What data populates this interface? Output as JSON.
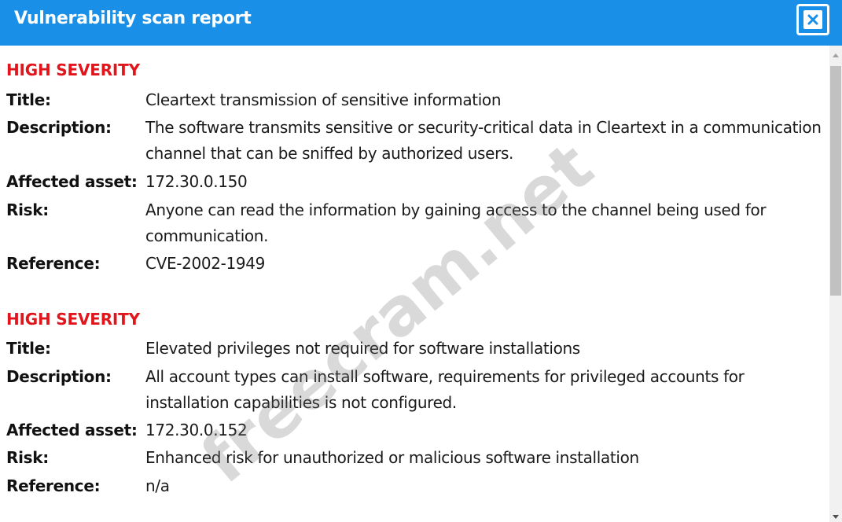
{
  "window": {
    "title": "Vulnerability scan report",
    "close_icon": "close-icon"
  },
  "colors": {
    "titlebar": "#1a8fe8",
    "severity": "#e0161c",
    "text": "#1a1a1a"
  },
  "labels": {
    "title": "Title:",
    "description": "Description:",
    "affected_asset": "Affected asset:",
    "risk": "Risk:",
    "reference": "Reference:"
  },
  "findings": [
    {
      "severity": "HIGH SEVERITY",
      "title": "Cleartext transmission of sensitive information",
      "description": "The software transmits sensitive or security-critical data in Cleartext in a communication channel that can be sniffed by authorized users.",
      "affected_asset": "172.30.0.150",
      "risk": "Anyone can read the information by gaining access to the channel being used for communication.",
      "reference": "CVE-2002-1949"
    },
    {
      "severity": "HIGH SEVERITY",
      "title": "Elevated privileges not required for software installations",
      "description": "All account types can install software, requirements for privileged accounts for installation capabilities is not configured.",
      "affected_asset": "172.30.0.152",
      "risk": "Enhanced risk for unauthorized or malicious software installation",
      "reference": "n/a"
    }
  ],
  "watermark": "freecram.net"
}
